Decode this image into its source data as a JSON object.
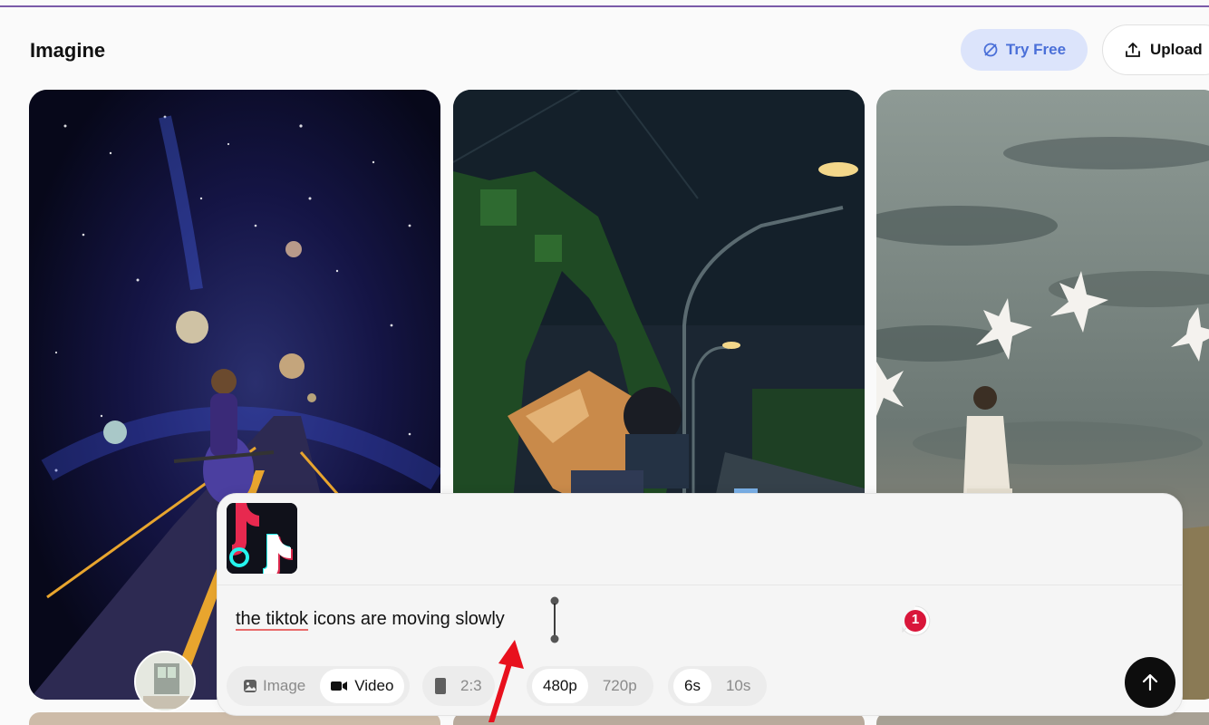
{
  "header": {
    "title": "Imagine",
    "try_free_label": "Try Free",
    "upload_label": "Upload"
  },
  "composer": {
    "prompt_underlined": "the tiktok",
    "prompt_rest": " icons are moving slowly",
    "badge_count": "1",
    "mode": {
      "image_label": "Image",
      "video_label": "Video",
      "selected": "Video"
    },
    "aspect_ratio": "2:3",
    "resolutions": [
      "480p",
      "720p"
    ],
    "selected_resolution": "480p",
    "durations": [
      "6s",
      "10s"
    ],
    "selected_duration": "6s"
  },
  "icons": {
    "try_free": "leaf-icon",
    "upload": "upload-icon",
    "image_mode": "image-icon",
    "video_mode": "video-camera-icon",
    "aspect_ratio": "portrait-rect-icon",
    "send": "arrow-up-icon",
    "attached_thumbnail": "tiktok-logo-image",
    "spellcheck_badge": "error-count-badge"
  },
  "colors": {
    "accent_purple_line": "#7a5aa8",
    "try_free_bg": "#dce4fb",
    "try_free_text": "#4a6fd8",
    "badge_red": "#d9163a",
    "annotation_arrow": "#e8101d",
    "send_button": "#0d0d0d"
  }
}
